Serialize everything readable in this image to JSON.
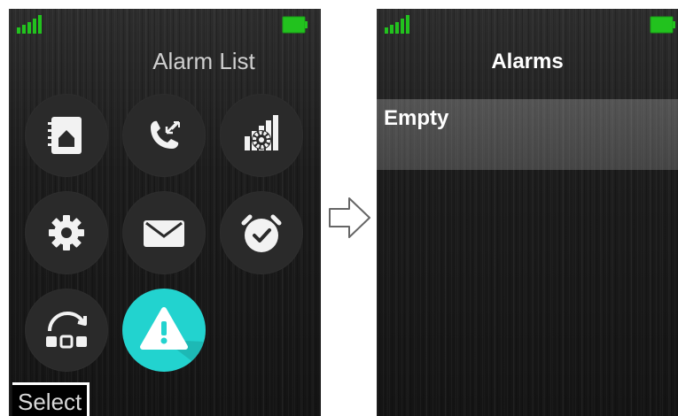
{
  "left_screen": {
    "title": "Alarm List",
    "softkey_label": "Select",
    "apps": [
      {
        "name": "contacts-app",
        "icon": "contacts-book-icon"
      },
      {
        "name": "call-log-app",
        "icon": "call-log-icon"
      },
      {
        "name": "settings-grid-app",
        "icon": "profile-settings-icon"
      },
      {
        "name": "settings-app",
        "icon": "gear-icon"
      },
      {
        "name": "messages-app",
        "icon": "envelope-icon"
      },
      {
        "name": "alarm-clock-app",
        "icon": "alarm-clock-icon"
      },
      {
        "name": "more-apps",
        "icon": "rotate-apps-icon"
      },
      {
        "name": "alarm-list-app",
        "icon": "warning-triangle-icon",
        "selected": true
      }
    ]
  },
  "right_screen": {
    "title": "Alarms",
    "items": [
      {
        "label": "Empty"
      }
    ]
  },
  "colors": {
    "signal": "#22c21e",
    "battery": "#22c21e",
    "selected_app": "#22d3cf"
  }
}
